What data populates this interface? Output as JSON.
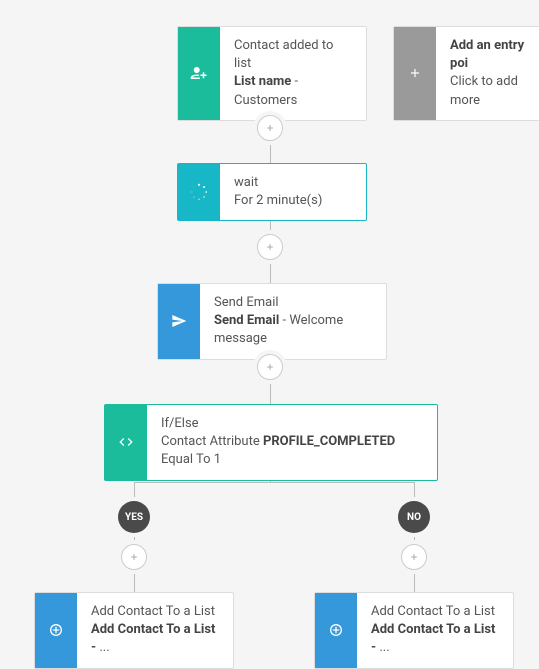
{
  "entry": {
    "title": "Contact added to list",
    "subtitle_bold": "List name",
    "subtitle_rest": " - Customers"
  },
  "add_entry_hint": {
    "title": "Add an entry poi",
    "subtitle": "Click to add more"
  },
  "wait": {
    "title": "wait",
    "subtitle": "For 2 minute(s)"
  },
  "send_email": {
    "title": "Send Email",
    "subtitle_bold": "Send Email",
    "subtitle_rest": " - Welcome message"
  },
  "if_else": {
    "title": "If/Else",
    "subtitle_prefix": "Contact Attribute ",
    "subtitle_bold": "PROFILE_COMPLETED",
    "subtitle_suffix": " Equal To 1"
  },
  "branches": {
    "yes": "YES",
    "no": "NO"
  },
  "add_contact_left": {
    "title": "Add Contact To a List",
    "subtitle_bold": "Add Contact To a List - ",
    "subtitle_rest": "..."
  },
  "add_contact_right": {
    "title": "Add Contact To a List",
    "subtitle_bold": "Add Contact To a List - ",
    "subtitle_rest": "..."
  },
  "icons": {
    "user_plus": "user-plus-icon",
    "plus": "+",
    "spinner": "spinner-icon",
    "paper_plane": "paper-plane-icon",
    "code": "code-icon"
  }
}
